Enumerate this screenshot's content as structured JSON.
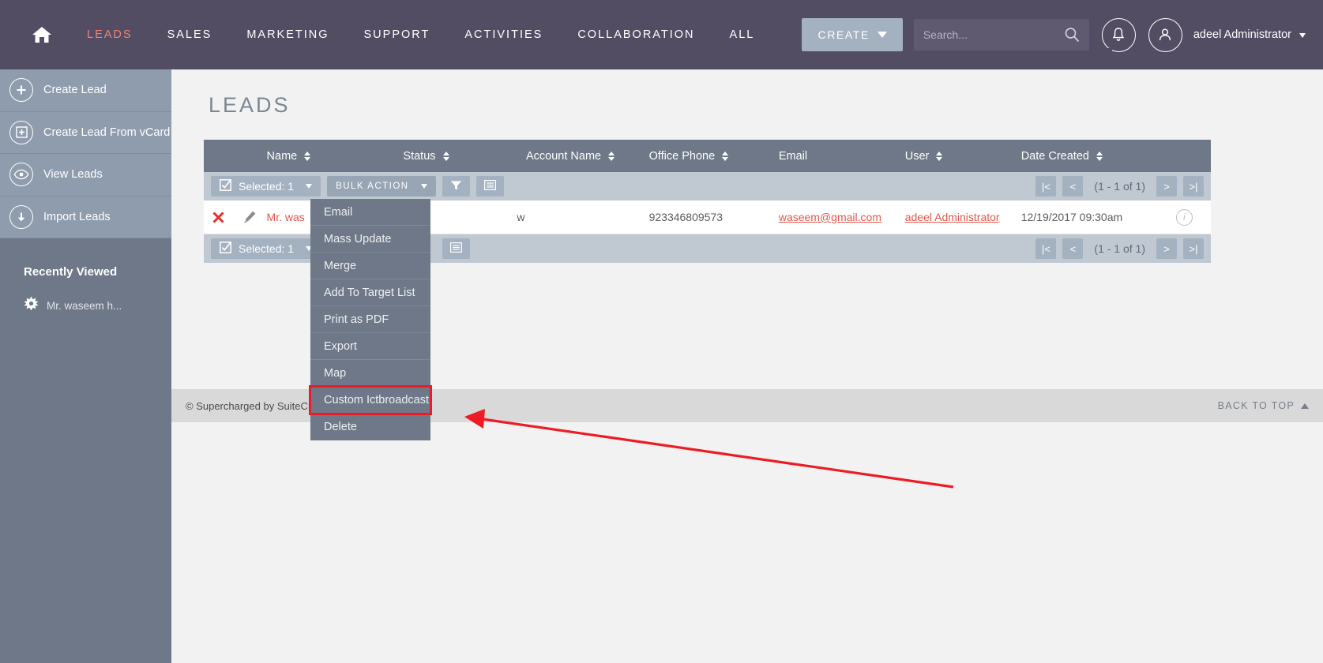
{
  "topnav": {
    "home_icon": "home-icon",
    "links": [
      {
        "label": "LEADS",
        "active": true
      },
      {
        "label": "SALES",
        "active": false
      },
      {
        "label": "MARKETING",
        "active": false
      },
      {
        "label": "SUPPORT",
        "active": false
      },
      {
        "label": "ACTIVITIES",
        "active": false
      },
      {
        "label": "COLLABORATION",
        "active": false
      },
      {
        "label": "ALL",
        "active": false
      }
    ],
    "create_label": "CREATE",
    "search_placeholder": "Search...",
    "search_value": "",
    "notification_icon": "bell-icon",
    "user_icon": "user-avatar-icon",
    "username": "adeel Administrator",
    "bg_color": "#534d64",
    "active_color": "#f08377"
  },
  "sidebar": {
    "actions": [
      {
        "label": "Create Lead",
        "icon": "plus-circle-icon"
      },
      {
        "label": "Create Lead From vCard",
        "icon": "plus-square-icon"
      },
      {
        "label": "View Leads",
        "icon": "eye-icon"
      },
      {
        "label": "Import Leads",
        "icon": "download-arrow-icon"
      }
    ],
    "recently_viewed_title": "Recently Viewed",
    "recent_items": [
      {
        "label": "Mr. waseem h...",
        "icon": "star-burst-icon"
      }
    ]
  },
  "main": {
    "page_title": "LEADS",
    "columns": [
      {
        "label": "Name",
        "sortable": true
      },
      {
        "label": "Status",
        "sortable": true
      },
      {
        "label": "Account Name",
        "sortable": true
      },
      {
        "label": "Office Phone",
        "sortable": true
      },
      {
        "label": "Email",
        "sortable": false
      },
      {
        "label": "User",
        "sortable": true
      },
      {
        "label": "Date Created",
        "sortable": true
      }
    ],
    "toolbar": {
      "selected_label": "Selected: 1",
      "selected_icon": "checkbox-checked-icon",
      "bulk_action_label": "BULK ACTION",
      "filter_icon": "funnel-icon",
      "columns_icon": "list-lines-icon"
    },
    "pagination": {
      "first_label": "|<",
      "prev_label": "<",
      "count_label": "(1 - 1 of 1)",
      "next_label": ">",
      "last_label": ">|"
    },
    "row": {
      "delete_icon": "red-x-icon",
      "edit_icon": "pencil-icon",
      "name": "Mr. was",
      "status": "w",
      "account_name": "",
      "office_phone": "923346809573",
      "email": "waseem@gmail.com",
      "user": "adeel Administrator",
      "date_created": "12/19/2017 09:30am",
      "info_icon": "info-icon"
    }
  },
  "bulk_menu": {
    "items": [
      {
        "label": "Email",
        "highlighted": false
      },
      {
        "label": "Mass Update",
        "highlighted": false
      },
      {
        "label": "Merge",
        "highlighted": false
      },
      {
        "label": "Add To Target List",
        "highlighted": false
      },
      {
        "label": "Print as PDF",
        "highlighted": false
      },
      {
        "label": "Export",
        "highlighted": false
      },
      {
        "label": "Map",
        "highlighted": false
      },
      {
        "label": "Custom Ictbroadcast",
        "highlighted": true
      },
      {
        "label": "Delete",
        "highlighted": false
      }
    ],
    "highlight_color": "#ed1c24"
  },
  "footer": {
    "left_text": "© Supercharged by SuiteCRM",
    "back_to_top": "BACK TO TOP"
  },
  "annotation": {
    "arrow_color": "#ed1c24",
    "points_to": "Custom Ictbroadcast"
  }
}
